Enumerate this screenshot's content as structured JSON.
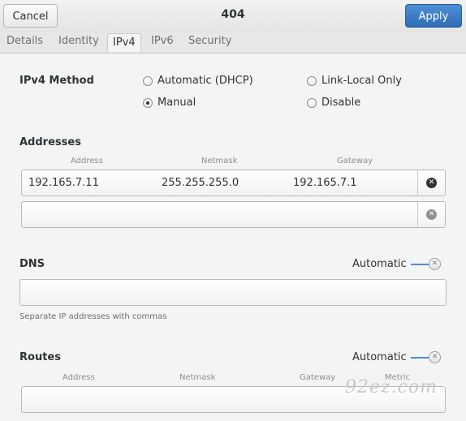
{
  "titlebar": {
    "cancel_label": "Cancel",
    "title": "404",
    "apply_label": "Apply"
  },
  "tabs": [
    {
      "label": "Details"
    },
    {
      "label": "Identity"
    },
    {
      "label": "IPv4"
    },
    {
      "label": "IPv6"
    },
    {
      "label": "Security"
    }
  ],
  "active_tab": "IPv4",
  "ipv4_method": {
    "label": "IPv4 Method",
    "options": [
      {
        "label": "Automatic (DHCP)",
        "checked": false
      },
      {
        "label": "Link-Local Only",
        "checked": false
      },
      {
        "label": "Manual",
        "checked": true
      },
      {
        "label": "Disable",
        "checked": false
      }
    ]
  },
  "addresses": {
    "heading": "Addresses",
    "columns": [
      "Address",
      "Netmask",
      "Gateway"
    ],
    "rows": [
      {
        "address": "192.165.7.11",
        "netmask": "255.255.255.0",
        "gateway": "192.165.7.1"
      },
      {
        "address": "",
        "netmask": "",
        "gateway": ""
      }
    ]
  },
  "dns": {
    "heading": "DNS",
    "automatic_label": "Automatic",
    "automatic_on": false,
    "value": "",
    "hint": "Separate IP addresses with commas"
  },
  "routes": {
    "heading": "Routes",
    "automatic_label": "Automatic",
    "automatic_on": false,
    "columns": [
      "Address",
      "Netmask",
      "Gateway",
      "Metric"
    ]
  },
  "watermark": "92ez.com",
  "colors": {
    "accent": "#4a90d9",
    "apply_button": "#3a7cc4"
  }
}
